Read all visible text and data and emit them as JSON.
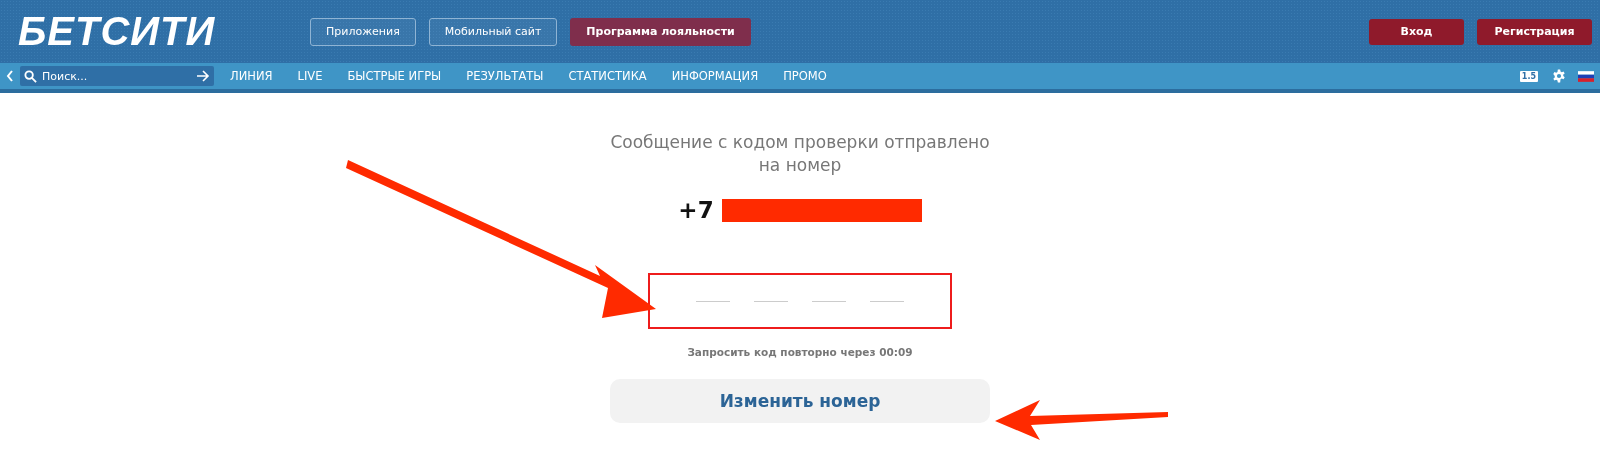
{
  "header": {
    "logo": "БЕТСИТИ",
    "links": [
      {
        "label": "Приложения",
        "kind": "outline"
      },
      {
        "label": "Мобильный сайт",
        "kind": "outline"
      },
      {
        "label": "Программа лояльности",
        "kind": "promo"
      }
    ],
    "auth_buttons": [
      {
        "label": "Вход"
      },
      {
        "label": "Регистрация"
      }
    ]
  },
  "nav": {
    "search": {
      "placeholder": "Поиск..."
    },
    "items": [
      {
        "label": "ЛИНИЯ"
      },
      {
        "label": "LIVE"
      },
      {
        "label": "БЫСТРЫЕ ИГРЫ"
      },
      {
        "label": "РЕЗУЛЬТАТЫ"
      },
      {
        "label": "СТАТИСТИКА"
      },
      {
        "label": "ИНФОРМАЦИЯ"
      },
      {
        "label": "ПРОМО"
      }
    ],
    "odds_format": "1.5"
  },
  "verification": {
    "message": "Сообщение с кодом проверки отправлено на номер",
    "phone_prefix": "+7",
    "phone_redacted": true,
    "code_slots": [
      {
        "filled": false
      },
      {
        "filled": false
      },
      {
        "filled": false
      },
      {
        "filled": false
      }
    ],
    "code_highlighted": true,
    "resend_note": "Запросить код повторно через 00:09",
    "change_button": "Изменить номер"
  }
}
